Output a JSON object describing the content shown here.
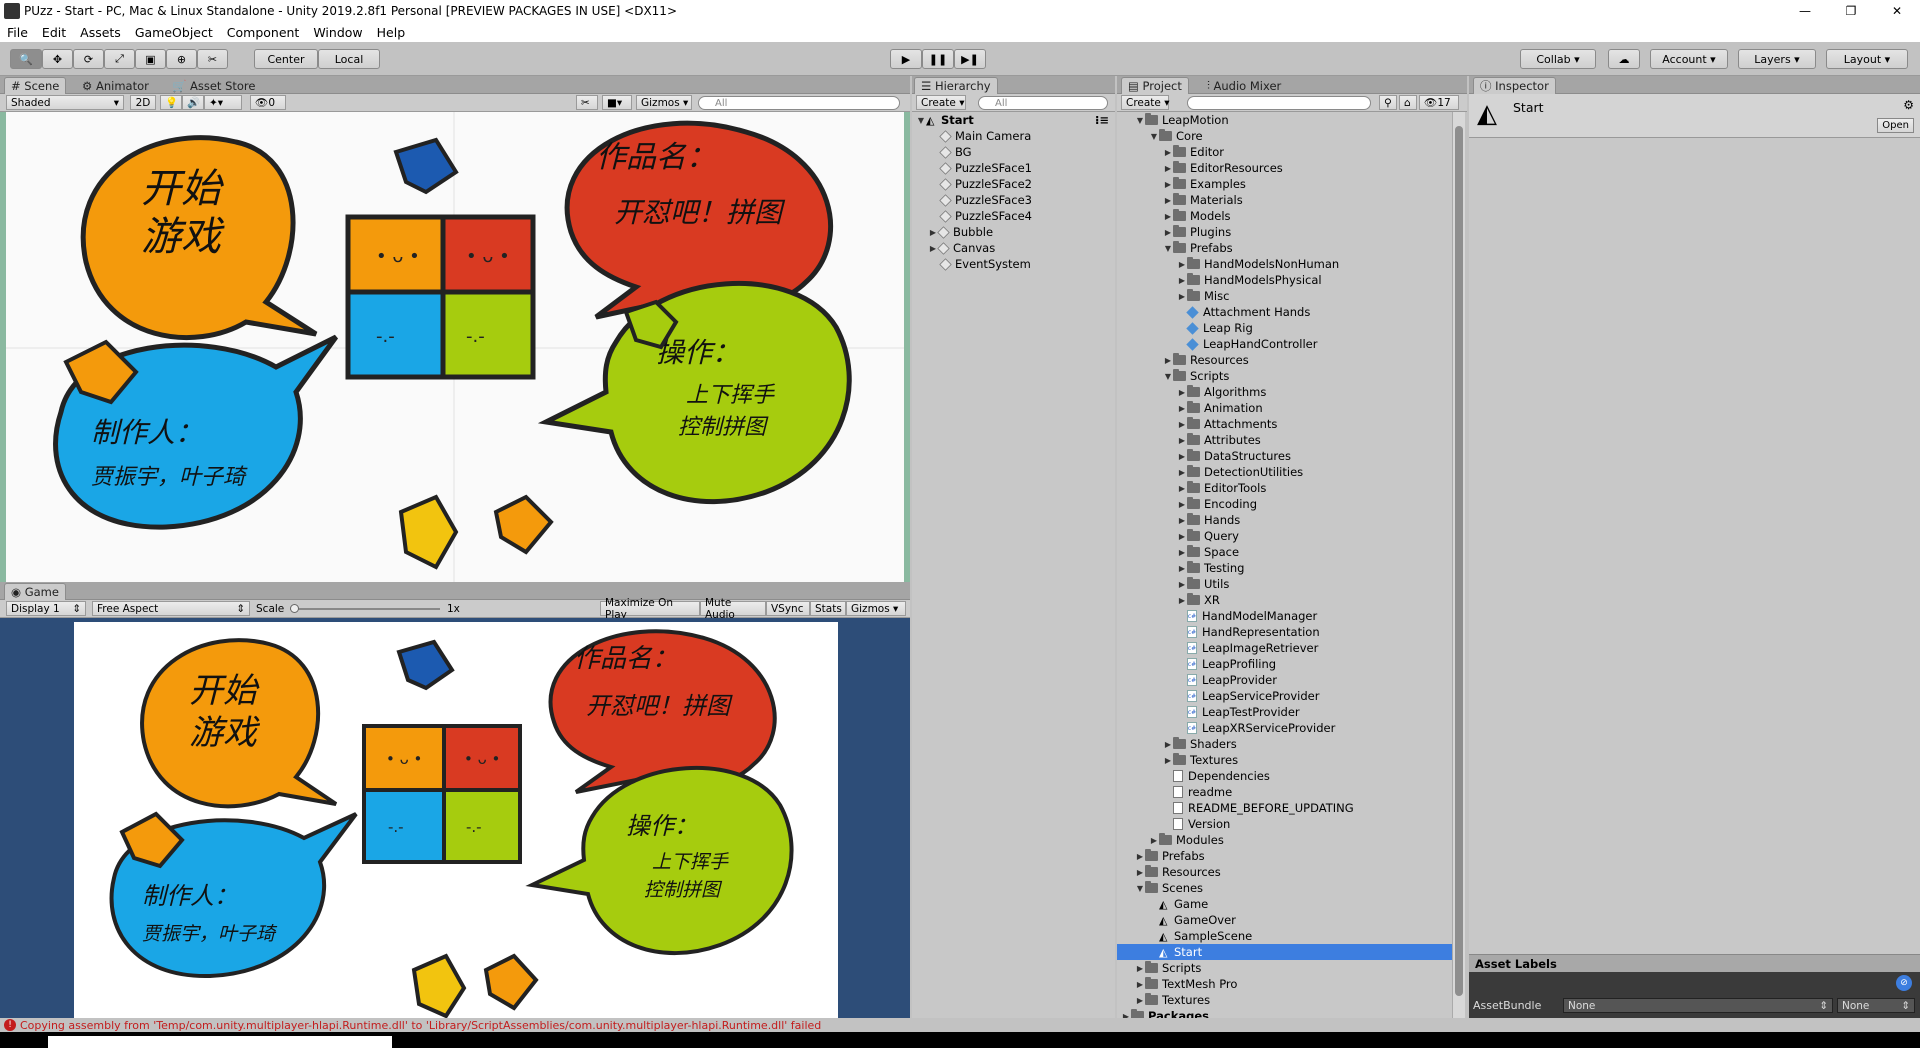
{
  "window": {
    "title": "PUzz - Start - PC, Mac & Linux Standalone - Unity 2019.2.8f1 Personal [PREVIEW PACKAGES IN USE] <DX11>"
  },
  "menu": [
    "File",
    "Edit",
    "Assets",
    "GameObject",
    "Component",
    "Window",
    "Help"
  ],
  "toolbar": {
    "pivot": "Center",
    "space": "Local",
    "collab": "Collab",
    "account": "Account",
    "layers": "Layers",
    "layout": "Layout"
  },
  "scene": {
    "tabs": [
      "Scene",
      "Animator",
      "Asset Store"
    ],
    "shading": "Shaded",
    "mode2d": "2D",
    "hidden_count": "0",
    "gizmos": "Gizmos",
    "search_placeholder": "All"
  },
  "game": {
    "tab": "Game",
    "display": "Display 1",
    "aspect": "Free Aspect",
    "scale_label": "Scale",
    "scale_value": "1x",
    "buttons": [
      "Maximize On Play",
      "Mute Audio",
      "VSync",
      "Stats",
      "Gizmos"
    ]
  },
  "artwork": {
    "start": "开始\n游戏",
    "title_label": "作品名：",
    "title_value": "开怼吧！拼图",
    "author_label": "制作人：",
    "authors": "贾振宇，叶子琦",
    "ops_label": "操作：",
    "ops_line1": "上下挥手",
    "ops_line2": "控制拼图"
  },
  "hierarchy": {
    "tab": "Hierarchy",
    "create": "Create",
    "search_placeholder": "All",
    "scene": "Start",
    "items": [
      "Main Camera",
      "BG",
      "PuzzleSFace1",
      "PuzzleSFace2",
      "PuzzleSFace3",
      "PuzzleSFace4",
      "Bubble",
      "Canvas",
      "EventSystem"
    ]
  },
  "project": {
    "tabs": [
      "Project",
      "Audio Mixer"
    ],
    "create": "Create",
    "badge": "17",
    "tree": [
      {
        "label": "LeapMotion",
        "depth": 0,
        "type": "folder",
        "open": true
      },
      {
        "label": "Core",
        "depth": 1,
        "type": "folder",
        "open": true
      },
      {
        "label": "Editor",
        "depth": 2,
        "type": "folder"
      },
      {
        "label": "EditorResources",
        "depth": 2,
        "type": "folder"
      },
      {
        "label": "Examples",
        "depth": 2,
        "type": "folder"
      },
      {
        "label": "Materials",
        "depth": 2,
        "type": "folder"
      },
      {
        "label": "Models",
        "depth": 2,
        "type": "folder"
      },
      {
        "label": "Plugins",
        "depth": 2,
        "type": "folder"
      },
      {
        "label": "Prefabs",
        "depth": 2,
        "type": "folder",
        "open": true
      },
      {
        "label": "HandModelsNonHuman",
        "depth": 3,
        "type": "folder"
      },
      {
        "label": "HandModelsPhysical",
        "depth": 3,
        "type": "folder"
      },
      {
        "label": "Misc",
        "depth": 3,
        "type": "folder"
      },
      {
        "label": "Attachment Hands",
        "depth": 3,
        "type": "prefab"
      },
      {
        "label": "Leap Rig",
        "depth": 3,
        "type": "prefab"
      },
      {
        "label": "LeapHandController",
        "depth": 3,
        "type": "prefab"
      },
      {
        "label": "Resources",
        "depth": 2,
        "type": "folder"
      },
      {
        "label": "Scripts",
        "depth": 2,
        "type": "folder",
        "open": true
      },
      {
        "label": "Algorithms",
        "depth": 3,
        "type": "folder"
      },
      {
        "label": "Animation",
        "depth": 3,
        "type": "folder"
      },
      {
        "label": "Attachments",
        "depth": 3,
        "type": "folder"
      },
      {
        "label": "Attributes",
        "depth": 3,
        "type": "folder"
      },
      {
        "label": "DataStructures",
        "depth": 3,
        "type": "folder"
      },
      {
        "label": "DetectionUtilities",
        "depth": 3,
        "type": "folder"
      },
      {
        "label": "EditorTools",
        "depth": 3,
        "type": "folder"
      },
      {
        "label": "Encoding",
        "depth": 3,
        "type": "folder"
      },
      {
        "label": "Hands",
        "depth": 3,
        "type": "folder"
      },
      {
        "label": "Query",
        "depth": 3,
        "type": "folder"
      },
      {
        "label": "Space",
        "depth": 3,
        "type": "folder"
      },
      {
        "label": "Testing",
        "depth": 3,
        "type": "folder"
      },
      {
        "label": "Utils",
        "depth": 3,
        "type": "folder"
      },
      {
        "label": "XR",
        "depth": 3,
        "type": "folder"
      },
      {
        "label": "HandModelManager",
        "depth": 3,
        "type": "cs"
      },
      {
        "label": "HandRepresentation",
        "depth": 3,
        "type": "cs"
      },
      {
        "label": "LeapImageRetriever",
        "depth": 3,
        "type": "cs"
      },
      {
        "label": "LeapProfiling",
        "depth": 3,
        "type": "cs"
      },
      {
        "label": "LeapProvider",
        "depth": 3,
        "type": "cs"
      },
      {
        "label": "LeapServiceProvider",
        "depth": 3,
        "type": "cs"
      },
      {
        "label": "LeapTestProvider",
        "depth": 3,
        "type": "cs"
      },
      {
        "label": "LeapXRServiceProvider",
        "depth": 3,
        "type": "cs"
      },
      {
        "label": "Shaders",
        "depth": 2,
        "type": "folder"
      },
      {
        "label": "Textures",
        "depth": 2,
        "type": "folder"
      },
      {
        "label": "Dependencies",
        "depth": 2,
        "type": "doc"
      },
      {
        "label": "readme",
        "depth": 2,
        "type": "doc"
      },
      {
        "label": "README_BEFORE_UPDATING",
        "depth": 2,
        "type": "doc"
      },
      {
        "label": "Version",
        "depth": 2,
        "type": "doc"
      },
      {
        "label": "Modules",
        "depth": 1,
        "type": "folder"
      },
      {
        "label": "Prefabs",
        "depth": 0,
        "type": "folder"
      },
      {
        "label": "Resources",
        "depth": 0,
        "type": "folder"
      },
      {
        "label": "Scenes",
        "depth": 0,
        "type": "folder",
        "open": true
      },
      {
        "label": "Game",
        "depth": 1,
        "type": "scene"
      },
      {
        "label": "GameOver",
        "depth": 1,
        "type": "scene"
      },
      {
        "label": "SampleScene",
        "depth": 1,
        "type": "scene"
      },
      {
        "label": "Start",
        "depth": 1,
        "type": "scene",
        "selected": true
      },
      {
        "label": "Scripts",
        "depth": 0,
        "type": "folder"
      },
      {
        "label": "TextMesh Pro",
        "depth": 0,
        "type": "folder"
      },
      {
        "label": "Textures",
        "depth": 0,
        "type": "folder"
      },
      {
        "label": "Packages",
        "depth": -1,
        "type": "folder",
        "bold": true
      }
    ]
  },
  "inspector": {
    "tab": "Inspector",
    "asset_name": "Start",
    "open_button": "Open",
    "asset_labels": "Asset Labels",
    "asset_bundle": "AssetBundle",
    "bundle_value": "None",
    "variant_value": "None"
  },
  "status": {
    "message": "Copying assembly from 'Temp/com.unity.multiplayer-hlapi.Runtime.dll' to 'Library/ScriptAssemblies/com.unity.multiplayer-hlapi.Runtime.dll' failed"
  },
  "colors": {
    "accent": "#3d7ee0",
    "orange": "#f49a0c",
    "red": "#d93a22",
    "blue": "#1aa6e6",
    "green": "#a6cc0e",
    "game_bg": "#2d4d78"
  }
}
